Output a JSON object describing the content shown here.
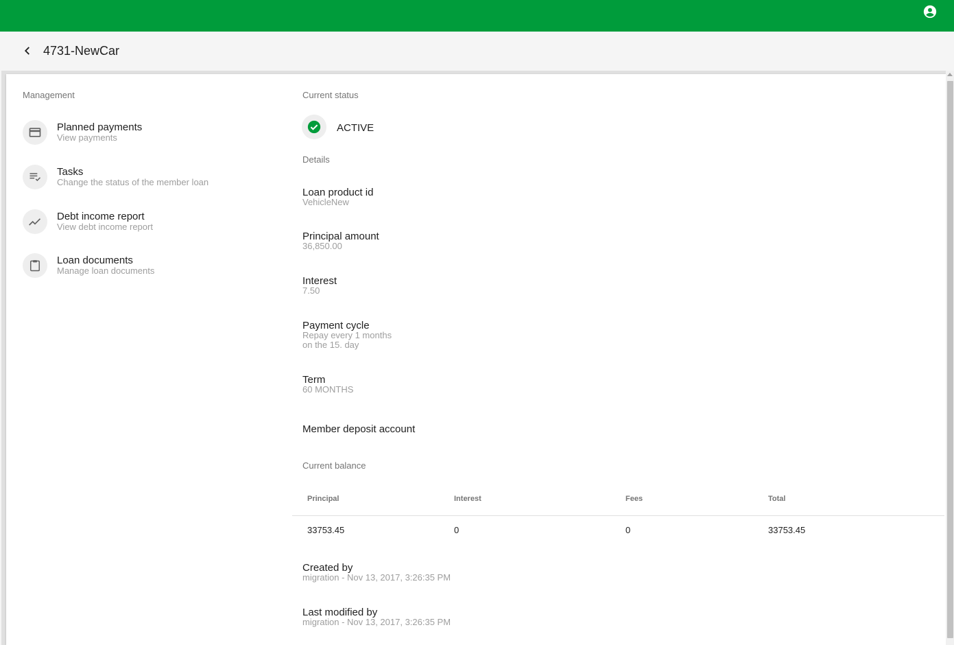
{
  "header": {
    "title": "4731-NewCar",
    "brand_color": "#009c3b"
  },
  "management": {
    "label": "Management",
    "items": [
      {
        "title": "Planned payments",
        "subtitle": "View payments",
        "icon": "credit-card-icon"
      },
      {
        "title": "Tasks",
        "subtitle": "Change the status of the member loan",
        "icon": "playlist-check-icon"
      },
      {
        "title": "Debt income report",
        "subtitle": "View debt income report",
        "icon": "trending-up-icon"
      },
      {
        "title": "Loan documents",
        "subtitle": "Manage loan documents",
        "icon": "clipboard-icon"
      }
    ]
  },
  "status": {
    "label": "Current status",
    "value": "ACTIVE",
    "icon": "check-circle-icon",
    "color": "#009c3b"
  },
  "details": {
    "label": "Details",
    "loan_product_id": {
      "title": "Loan product id",
      "value": "VehicleNew"
    },
    "principal_amount": {
      "title": "Principal amount",
      "value": "36,850.00"
    },
    "interest": {
      "title": "Interest",
      "value": "7.50"
    },
    "payment_cycle": {
      "title": "Payment cycle",
      "line1": "Repay every 1 months",
      "line2": "on the 15. day"
    },
    "term": {
      "title": "Term",
      "value": "60 MONTHS"
    },
    "member_deposit_account": {
      "title": "Member deposit account"
    }
  },
  "balance": {
    "label": "Current balance",
    "columns": [
      "Principal",
      "Interest",
      "Fees",
      "Total"
    ],
    "row": [
      "33753.45",
      "0",
      "0",
      "33753.45"
    ]
  },
  "audit": {
    "created_by": {
      "title": "Created by",
      "value": "migration - Nov 13, 2017, 3:26:35 PM"
    },
    "last_modified_by": {
      "title": "Last modified by",
      "value": "migration - Nov 13, 2017, 3:26:35 PM"
    }
  }
}
